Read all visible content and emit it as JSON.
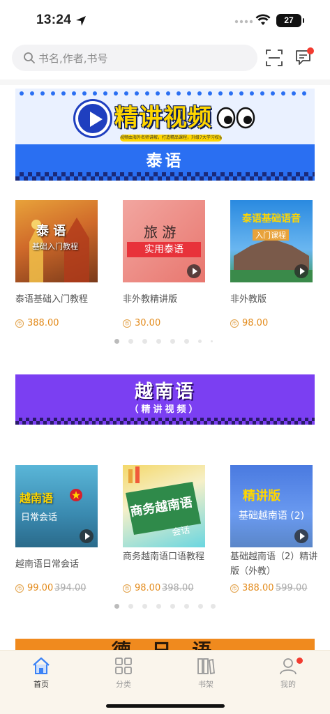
{
  "status_bar": {
    "time": "13:24",
    "battery": "27"
  },
  "header": {
    "search_placeholder": "书名,作者,书号"
  },
  "thai_section": {
    "banner_title": "精讲视频",
    "banner_subtitle": "视频由海外名师讲解，打造精品课程，升级7大学习权益",
    "banner_lang": "泰语",
    "items": [
      {
        "thumb_line1": "泰 语",
        "thumb_line2": "基础入门教程",
        "title": "泰语基础入门教程",
        "price": "388.00"
      },
      {
        "thumb_line1": "旅 游",
        "thumb_line2": "实用泰语",
        "title": "非外教精讲版",
        "price": "30.00"
      },
      {
        "thumb_line1": "泰语基础语音",
        "thumb_line2": "入门课程",
        "title": "非外教版",
        "price": "98.00"
      }
    ]
  },
  "vietnamese_section": {
    "banner_title": "越南语",
    "banner_subtitle": "（精讲视频）",
    "items": [
      {
        "thumb_line1": "越南语",
        "thumb_line2": "日常会话",
        "title": "越南语日常会话",
        "price": "99.00",
        "old_price": "394.00"
      },
      {
        "thumb_line1": "商务越南语",
        "thumb_line2": "会话",
        "title": "商务越南语口语教程",
        "price": "98.00",
        "old_price": "398.00"
      },
      {
        "thumb_line1": "精讲版",
        "thumb_line2": "基础越南语 (2)",
        "title": "基础越南语（2）精讲版（外教）",
        "price": "388.00",
        "old_price": "599.00"
      }
    ]
  },
  "next_section": {
    "banner_title": "德 日 语"
  },
  "tabbar": {
    "tabs": [
      {
        "label": "首页",
        "active": true
      },
      {
        "label": "分类",
        "active": false
      },
      {
        "label": "书架",
        "active": false
      },
      {
        "label": "我的",
        "active": false
      }
    ]
  },
  "colors": {
    "accent_price": "#e38b1c",
    "thai_banner": "#2a6ff2",
    "viet_banner": "#7b3ff2",
    "notify_dot": "#f23b30",
    "home_tab": "#3b82f6"
  }
}
